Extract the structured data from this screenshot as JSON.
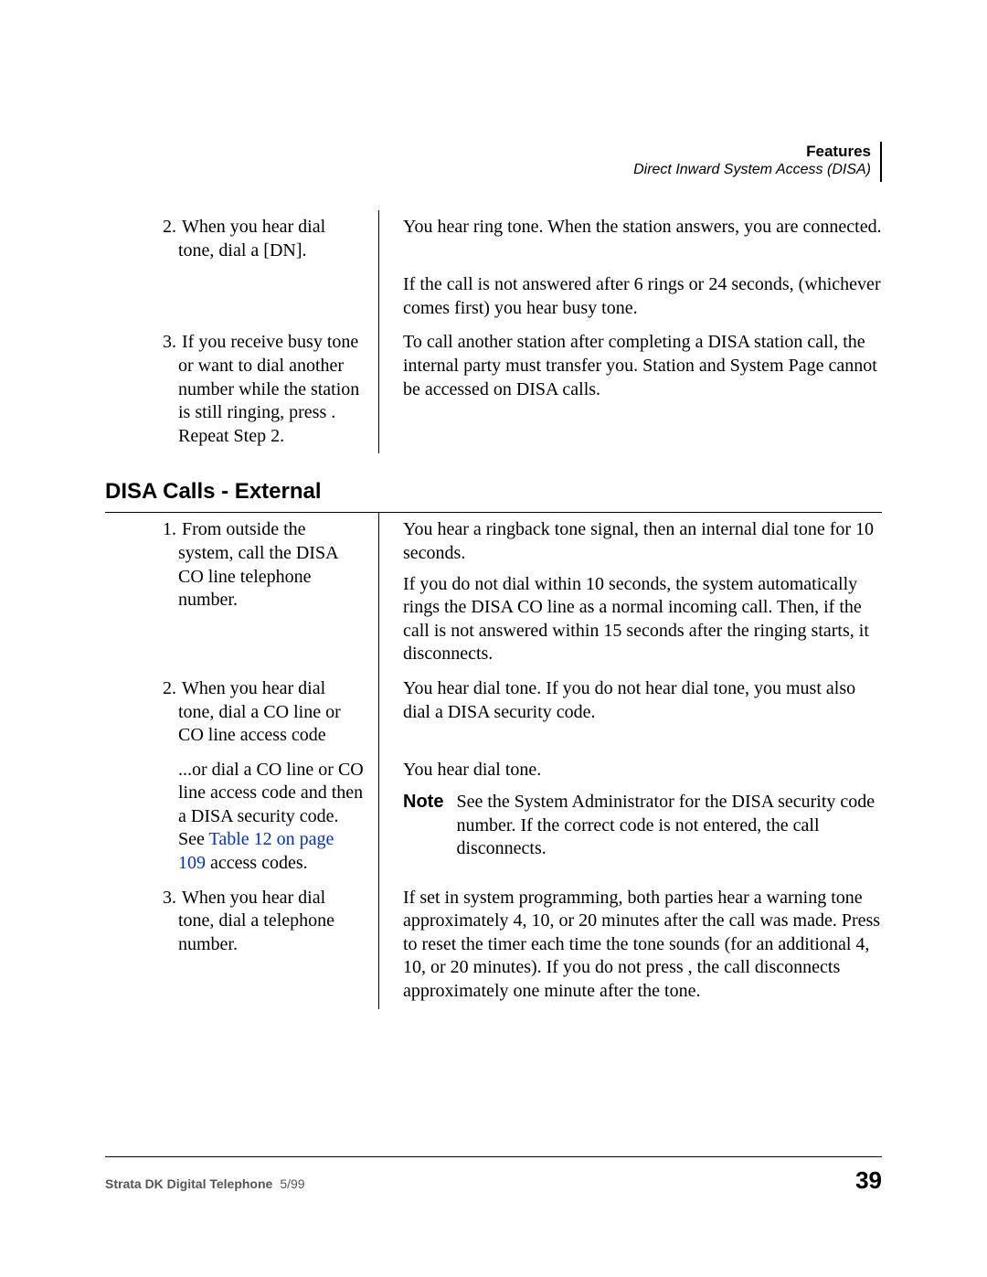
{
  "header": {
    "chapter": "Features",
    "section": "Direct Inward System Access (DISA)"
  },
  "table1": {
    "row2_left_num": "2.",
    "row2_left": "When you hear dial tone, dial a [DN].",
    "row2_right_a": "You hear ring tone. When the station answers, you are connected.",
    "row2_right_b": "If the call is not answered after 6 rings or 24 seconds, (whichever comes first) you hear busy tone.",
    "row3_left_num": "3.",
    "row3_left": "If you receive busy tone or want to dial another number while the station is still ringing, press     . Repeat Step 2.",
    "row3_right": "To call another station after completing a DISA station call, the internal party must transfer you. Station and System Page cannot be accessed on DISA calls."
  },
  "heading": "DISA Calls - External",
  "table2": {
    "r1_num": "1.",
    "r1_left": "From outside the system, call the DISA CO line telephone number.",
    "r1_right_a": "You hear a ringback tone signal, then an internal dial tone for 10 seconds.",
    "r1_right_b": "If you do not dial within 10 seconds, the system automatically rings the DISA CO line as a normal incoming call. Then, if the call is not answered within 15 seconds after the ringing starts, it disconnects.",
    "r2_num": "2.",
    "r2_left": "When you hear dial tone, dial a CO line or CO line access code",
    "r2_right": "You hear dial tone. If you do not hear dial tone, you must also dial a DISA security code.",
    "r2b_left_a": "...or dial a CO line or CO line access code and then a DISA security code. See ",
    "r2b_left_link": "Table 12 on page 109",
    "r2b_left_b": " access codes.",
    "r2b_right_a": "You hear dial tone.",
    "note_label": "Note",
    "r2b_note": "See the System Administrator for the DISA security code number. If the correct code is not entered, the call disconnects.",
    "r3_num": "3.",
    "r3_left": "When you hear dial tone, dial a telephone number.",
    "r3_right": "If set in system programming, both parties hear a warning tone approximately 4, 10, or 20 minutes after the call was made. Press      to reset the timer each time the tone sounds (for an additional 4, 10, or 20 minutes). If you do not press    , the call disconnects approximately one minute after the tone."
  },
  "footer": {
    "left": "Strata DK Digital Telephone",
    "date": "5/99",
    "page": "39"
  }
}
